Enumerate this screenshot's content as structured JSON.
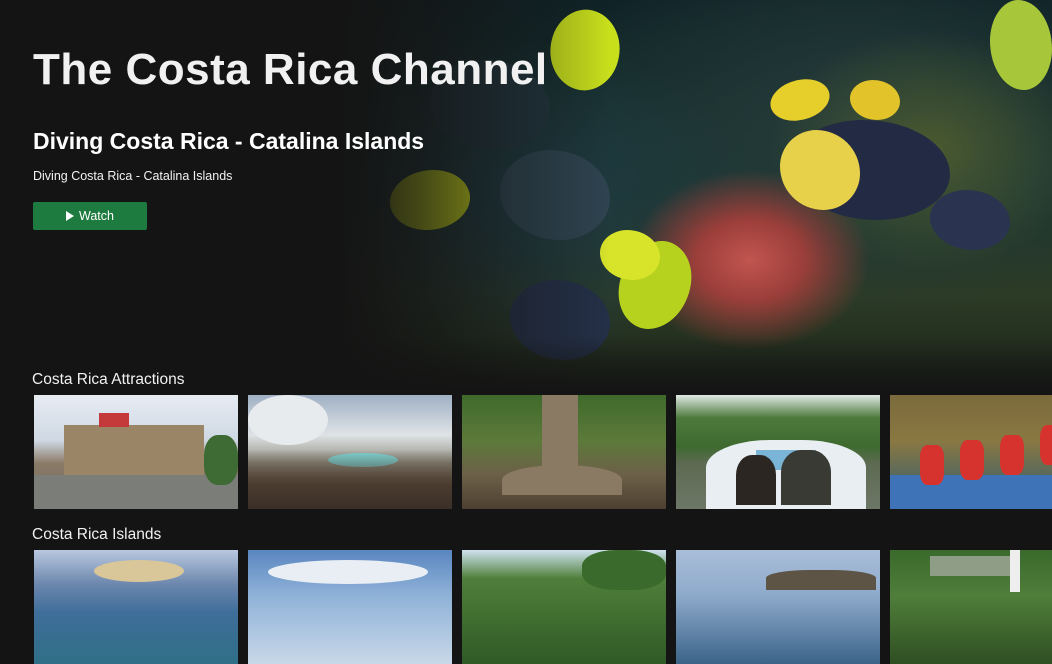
{
  "channel": {
    "title": "The Costa Rica Channel"
  },
  "featured": {
    "title": "Diving Costa Rica - Catalina Islands",
    "description": "Diving Costa Rica - Catalina Islands",
    "watch_label": "Watch",
    "image": "underwater-fish-reef"
  },
  "rows": [
    {
      "title": "Costa Rica Attractions",
      "items": [
        {
          "image": "national-theater-building"
        },
        {
          "image": "volcano-crater-tourists"
        },
        {
          "image": "jungle-tree-roots"
        },
        {
          "image": "river-boat-tour"
        },
        {
          "image": "white-water-rafting"
        }
      ]
    },
    {
      "title": "Costa Rica Islands",
      "items": [
        {
          "image": "aerial-island-beach"
        },
        {
          "image": "sky-over-sea"
        },
        {
          "image": "tropical-trees"
        },
        {
          "image": "rocky-island-coast"
        },
        {
          "image": "jungle-hut"
        }
      ]
    }
  ]
}
